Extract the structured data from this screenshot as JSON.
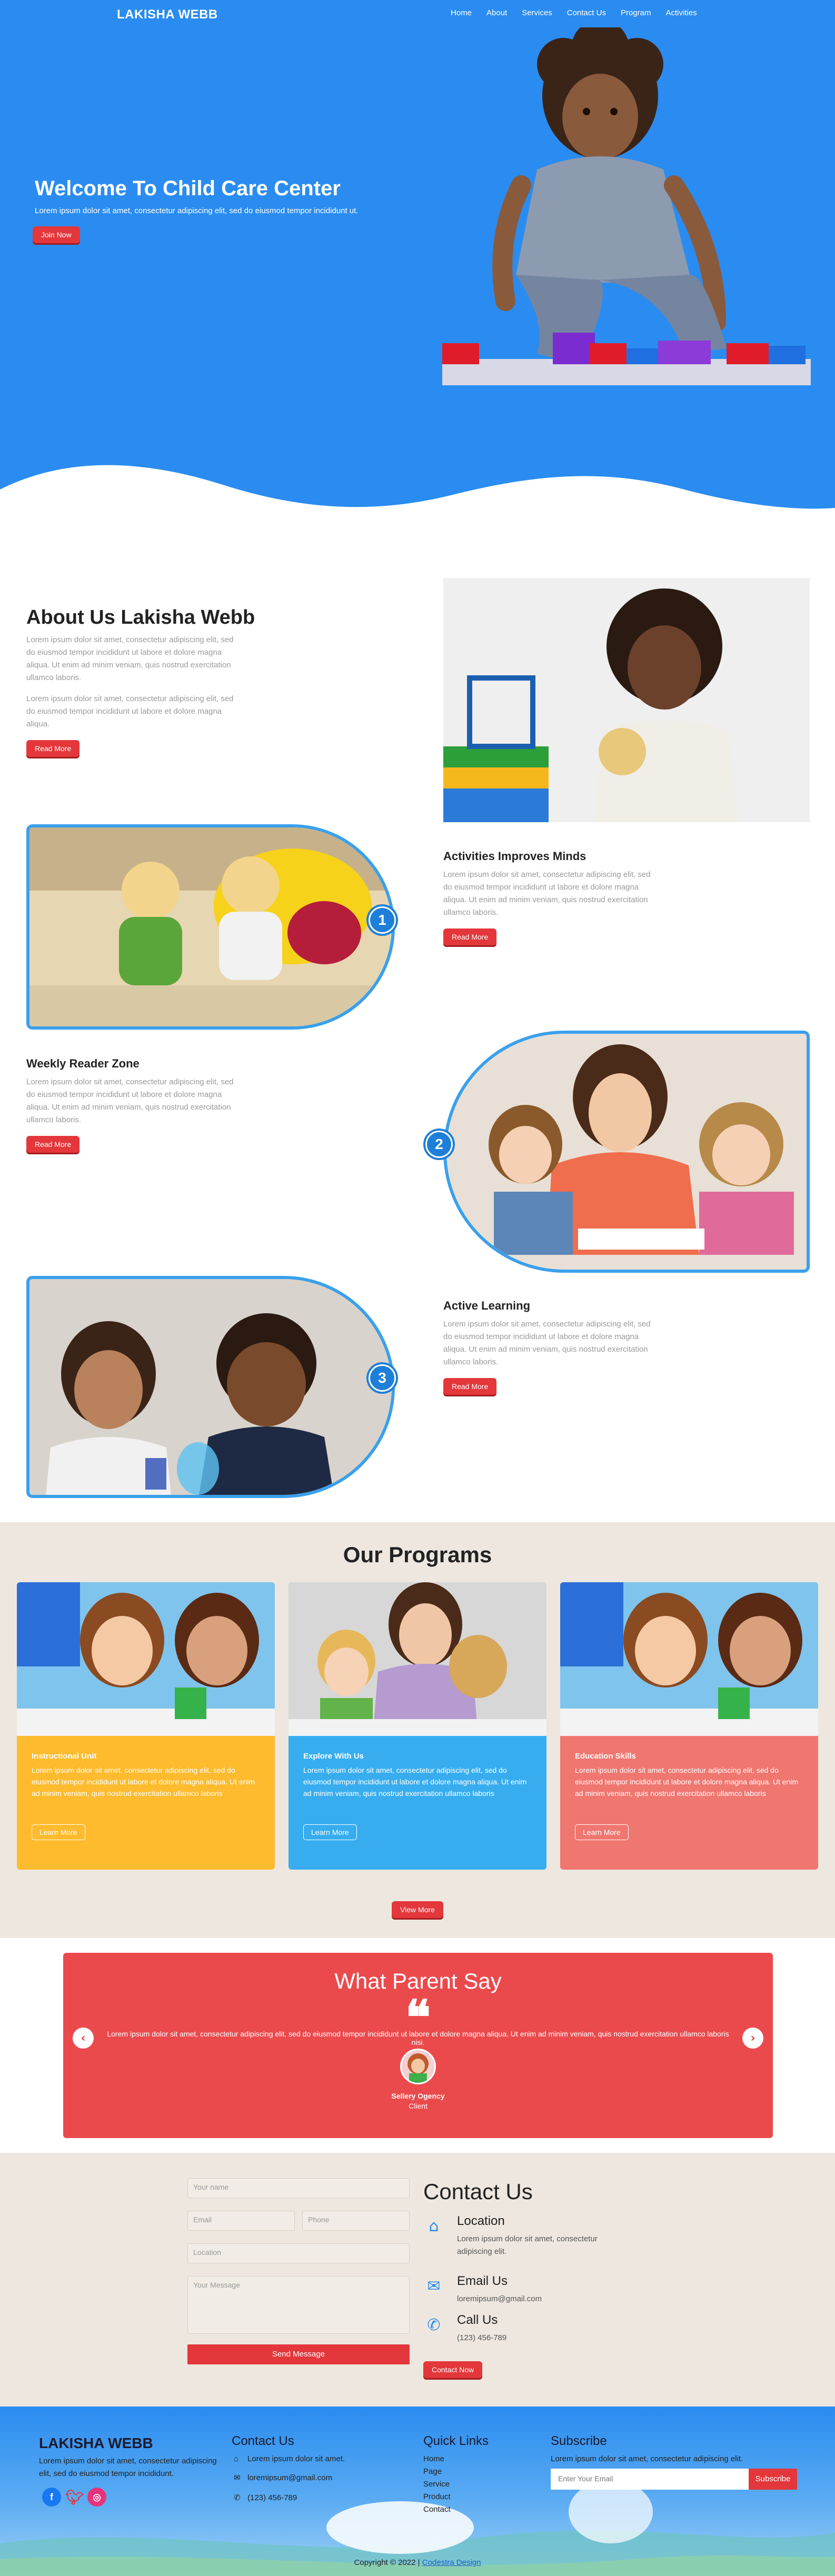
{
  "header": {
    "brand": "LAKISHA WEBB",
    "nav": [
      "Home",
      "About",
      "Services",
      "Contact Us",
      "Program",
      "Activities"
    ]
  },
  "hero": {
    "title": "Welcome To Child Care Center",
    "text": "Lorem ipsum dolor sit amet, consectetur adipiscing elit, sed do eiusmod tempor incididunt ut.",
    "button": "Join Now"
  },
  "about": {
    "title": "About Us Lakisha Webb",
    "p1": "Lorem ipsum dolor sit amet, consectetur adipiscing elit, sed do eiusmod tempor incididunt ut labore et dolore magna aliqua. Ut enim ad minim veniam, quis nostrud exercitation ullamco laboris.",
    "p2": "Lorem ipsum dolor sit amet, consectetur adipiscing elit, sed do eiusmod tempor incididunt ut labore et dolore magna aliqua.",
    "button": "Read More"
  },
  "features": [
    {
      "num": "1",
      "title": "Activities Improves Minds",
      "text": "Lorem ipsum dolor sit amet, consectetur adipiscing elit, sed do eiusmod tempor incididunt ut labore et dolore magna aliqua. Ut enim ad minim veniam, quis nostrud exercitation ullamco laboris.",
      "button": "Read More"
    },
    {
      "num": "2",
      "title": "Weekly Reader Zone",
      "text": "Lorem ipsum dolor sit amet, consectetur adipiscing elit, sed do eiusmod tempor incididunt ut labore et dolore magna aliqua. Ut enim ad minim veniam, quis nostrud exercitation ullamco laboris.",
      "button": "Read More"
    },
    {
      "num": "3",
      "title": "Active Learning",
      "text": "Lorem ipsum dolor sit amet, consectetur adipiscing elit, sed do eiusmod tempor incididunt ut labore et dolore magna aliqua. Ut enim ad minim veniam, quis nostrud exercitation ullamco laboris.",
      "button": "Read More"
    }
  ],
  "programs": {
    "title": "Our Programs",
    "cards": [
      {
        "title": "Instructional Unit",
        "text": "Lorem ipsum dolor sit amet, consectetur adipiscing elit, sed do eiusmod tempor incididunt ut labore et dolore magna aliqua. Ut enim ad minim veniam, quis nostrud exercitation ullamco laboris",
        "button": "Learn More",
        "color": "#fdbb2d"
      },
      {
        "title": "Explore With Us",
        "text": "Lorem ipsum dolor sit amet, consectetur adipiscing elit, sed do eiusmod tempor incididunt ut labore et dolore magna aliqua. Ut enim ad minim veniam, quis nostrud exercitation ullamco laboris",
        "button": "Learn More",
        "color": "#37adf0"
      },
      {
        "title": "Education Skills",
        "text": "Lorem ipsum dolor sit amet, consectetur adipiscing elit, sed do eiusmod tempor incididunt ut labore et dolore magna aliqua. Ut enim ad minim veniam, quis nostrud exercitation ullamco laboris",
        "button": "Learn More",
        "color": "#f07670"
      }
    ],
    "button": "View More"
  },
  "testimonial": {
    "title": "What Parent Say",
    "quote_mark": "❝",
    "text": "Lorem ipsum dolor sit amet, consectetur adipiscing elit, sed do eiusmod tempor incididunt ut labore et dolore magna aliqua. Ut enim ad minim veniam, quis nostrud exercitation ullamco laboris nisi.",
    "name": "Sellery Ogency",
    "role": "Client",
    "prev_icon": "‹",
    "next_icon": "›"
  },
  "contact": {
    "title": "Contact Us",
    "form": {
      "name_ph": "Your name",
      "email_ph": "Email",
      "phone_ph": "Phone",
      "location_ph": "Location",
      "message_ph": "Your Message",
      "send": "Send Message"
    },
    "location": {
      "title": "Location",
      "text": "Lorem ipsum dolor sit amet, consectetur adipiscing elit."
    },
    "email": {
      "title": "Email Us",
      "text": "loremipsum@gmail.com"
    },
    "call": {
      "title": "Call Us",
      "text": "(123) 456-789"
    },
    "button": "Contact Now"
  },
  "footer": {
    "brand": "LAKISHA WEBB",
    "brand_text": "Lorem ipsum dolor sit amet, consectetur adipiscing elit, sed do eiusmod tempor incididunt.",
    "social": [
      "f",
      "t",
      "◎"
    ],
    "contact_title": "Contact Us",
    "contact_items": [
      "Lorem ipsum dolor sit amet.",
      "loremipsum@gmail.com",
      "(123) 456-789"
    ],
    "links_title": "Quick Links",
    "links": [
      "Home",
      "Page",
      "Service",
      "Product",
      "Contact"
    ],
    "subscribe_title": "Subscribe",
    "subscribe_text": "Lorem ipsum dolor sit amet, consectetur adipiscing elit.",
    "subscribe_ph": "Enter Your Email",
    "subscribe_btn": "Subscribe",
    "copyright": "Copyright © 2022 |",
    "copyright_link": "Codestra Design"
  }
}
